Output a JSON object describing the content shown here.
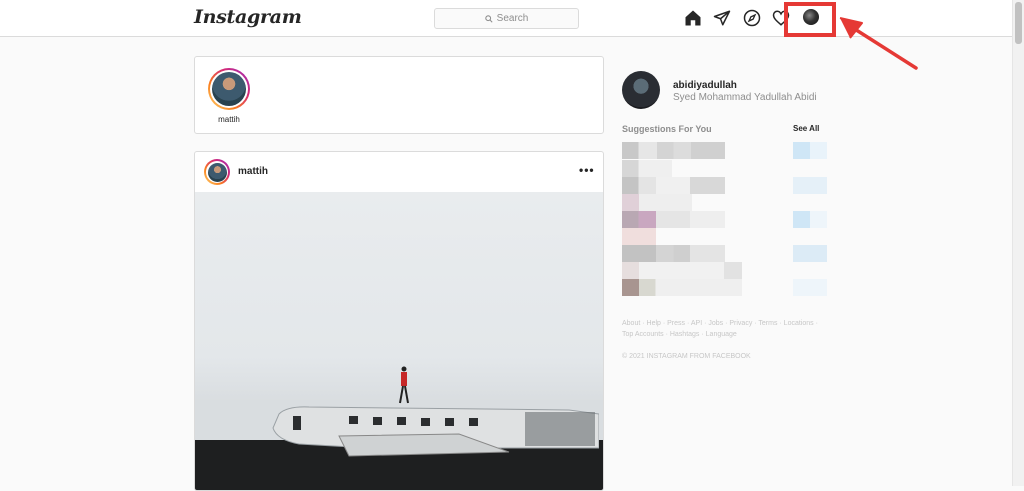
{
  "header": {
    "logo": "Instagram",
    "search_placeholder": "Search",
    "nav_icons": [
      "home-icon",
      "direct-icon",
      "explore-icon",
      "activity-heart-icon",
      "profile-avatar"
    ]
  },
  "stories": [
    {
      "username": "mattih"
    }
  ],
  "post": {
    "username": "mattih",
    "more_label": "•••"
  },
  "sidebar": {
    "username": "abidiyadullah",
    "full_name": "Syed Mohammad Yadullah Abidi",
    "suggestions_title": "Suggestions For You",
    "see_all": "See All",
    "footer_links": "About · Help · Press · API · Jobs · Privacy · Terms · Locations · Top Accounts · Hashtags · Language",
    "copyright": "© 2021 INSTAGRAM FROM FACEBOOK"
  },
  "colors": {
    "highlight_border": "#e53935",
    "background": "#fafafa",
    "border": "#dbdbdb"
  }
}
